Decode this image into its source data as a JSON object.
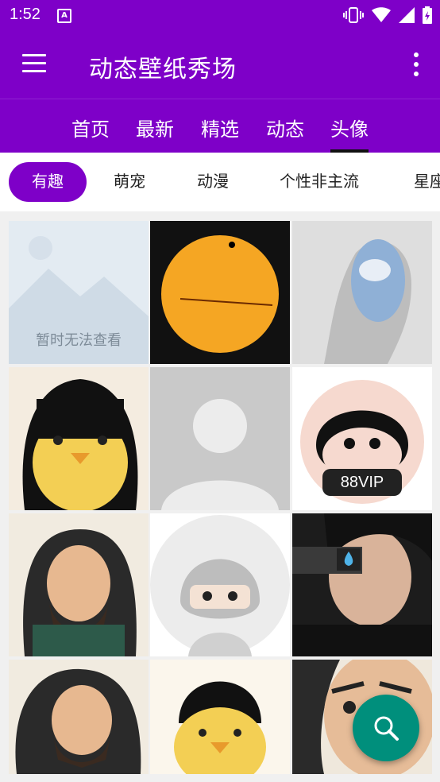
{
  "status_bar": {
    "time": "1:52",
    "notification_icon": "A"
  },
  "app_bar": {
    "title": "动态壁纸秀场"
  },
  "tabs": [
    {
      "label": "首页"
    },
    {
      "label": "最新"
    },
    {
      "label": "精选"
    },
    {
      "label": "动态"
    },
    {
      "label": "头像",
      "active": true
    }
  ],
  "chips": [
    {
      "label": "有趣",
      "active": true
    },
    {
      "label": "萌宠"
    },
    {
      "label": "动漫"
    },
    {
      "label": "个性非主流"
    },
    {
      "label": "星座"
    }
  ],
  "grid": {
    "placeholder_text": "暂时无法查看",
    "vip_text": "88VIP"
  },
  "colors": {
    "primary": "#7e00c8",
    "fab": "#008f7c"
  },
  "icons": [
    "menu-icon",
    "more-vert-icon",
    "search-icon",
    "vibrate-icon",
    "wifi-icon",
    "signal-icon",
    "battery-icon"
  ]
}
